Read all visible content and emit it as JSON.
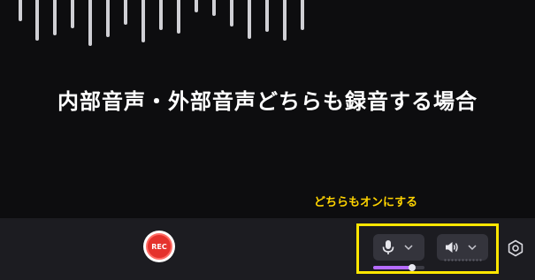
{
  "headline": "内部音声・外部音声どちらも録音する場合",
  "annotation": "どちらもオンにする",
  "record": {
    "label": "REC"
  },
  "mic": {
    "level": 0.75
  },
  "colors": {
    "record_red": "#e5322d",
    "highlight_yellow": "#ffe600",
    "annotation_yellow": "#ffd400",
    "mic_level_purple": "#b66cff"
  }
}
